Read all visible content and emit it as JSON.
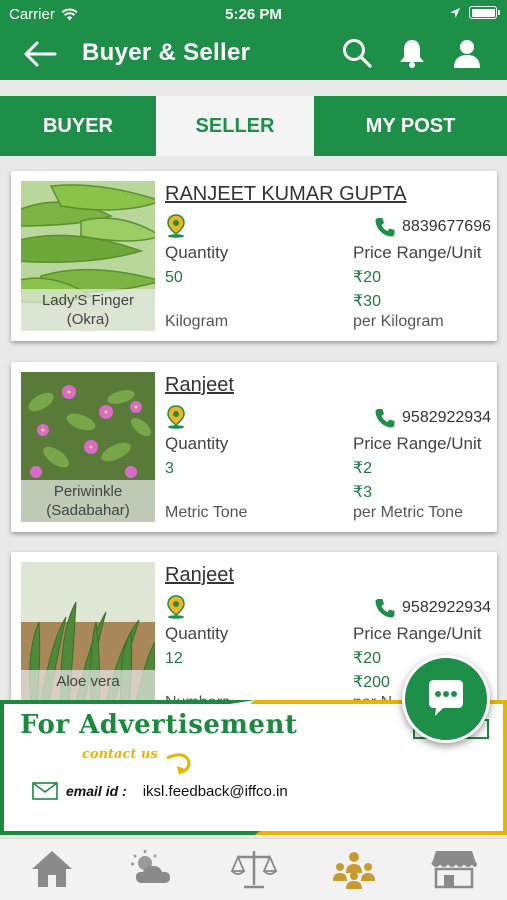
{
  "status": {
    "carrier": "Carrier",
    "time": "5:26 PM"
  },
  "header": {
    "title": "Buyer & Seller"
  },
  "tabs": [
    {
      "label": "BUYER",
      "active": false
    },
    {
      "label": "SELLER",
      "active": true
    },
    {
      "label": "MY POST",
      "active": false
    }
  ],
  "listings": [
    {
      "name": "RANJEET KUMAR GUPTA",
      "phone": "8839677696",
      "quantity_label": "Quantity",
      "quantity": "50",
      "quantity_unit": "Kilogram",
      "price_label": "Price Range/Unit",
      "price_min": "₹20",
      "price_max": "₹30",
      "price_unit": "per Kilogram",
      "crop": "Lady'S Finger (Okra)"
    },
    {
      "name": "Ranjeet",
      "phone": "9582922934",
      "quantity_label": "Quantity",
      "quantity": "3",
      "quantity_unit": "Metric Tone",
      "price_label": "Price Range/Unit",
      "price_min": "₹2",
      "price_max": "₹3",
      "price_unit": "per Metric Tone",
      "crop": "Periwinkle (Sadabahar)"
    },
    {
      "name": "Ranjeet",
      "phone": "9582922934",
      "quantity_label": "Quantity",
      "quantity": "12",
      "quantity_unit": "Numbers",
      "price_label": "Price Range/Unit",
      "price_min": "₹20",
      "price_max": "₹200",
      "price_unit": "per N",
      "crop": "Aloe vera"
    }
  ],
  "advertisement": {
    "title": "For Advertisement",
    "contact": "contact us",
    "email_label": "email id :",
    "email": "iksl.feedback@iffco.in"
  },
  "colors": {
    "primary": "#1d8f48",
    "accent": "#e8b400",
    "nav_active": "#c99a2e"
  },
  "icons": [
    "back-arrow-icon",
    "search-icon",
    "bell-icon",
    "user-icon",
    "location-pin-icon",
    "phone-icon",
    "chat-icon",
    "home-icon",
    "weather-icon",
    "scale-icon",
    "community-icon",
    "store-icon"
  ]
}
